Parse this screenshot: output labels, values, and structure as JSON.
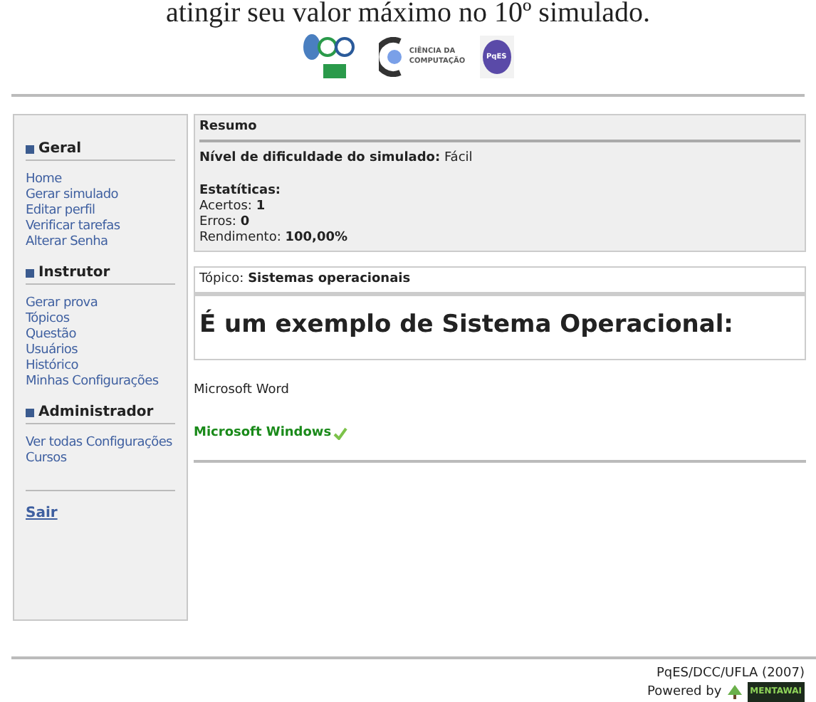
{
  "heading": "atingir seu valor máximo no 10º simulado.",
  "logos": {
    "computacao": [
      "CIÊNCIA DA",
      "COMPUTAÇÃO"
    ],
    "pqes": "PqES"
  },
  "sidebar": {
    "sections": [
      {
        "title": "Geral",
        "items": [
          "Home",
          "Gerar simulado",
          "Editar perfil",
          "Verificar tarefas",
          "Alterar Senha"
        ]
      },
      {
        "title": "Instrutor",
        "items": [
          "Gerar prova",
          "Tópicos",
          "Questão",
          "Usuários",
          "Histórico",
          "Minhas Configurações"
        ]
      },
      {
        "title": "Administrador",
        "items": [
          "Ver todas Configurações",
          "Cursos"
        ]
      }
    ],
    "exit": "Sair"
  },
  "summary": {
    "title": "Resumo",
    "difficulty_label": "Nível de dificuldade do simulado:",
    "difficulty": "Fácil",
    "stats_title": "Estatíticas:",
    "stats": [
      {
        "label": "Acertos:",
        "value": "1"
      },
      {
        "label": "Erros:",
        "value": "0"
      },
      {
        "label": "Rendimento:",
        "value": "100,00%"
      }
    ]
  },
  "question": {
    "topic_label": "Tópico:",
    "topic": "Sistemas operacionais",
    "text": "É um exemplo de Sistema Operacional:",
    "options": [
      {
        "text": "Microsoft Word",
        "correct": false
      },
      {
        "text": "Microsoft Windows",
        "correct": true
      }
    ]
  },
  "footer": {
    "credit": "PqES/DCC/UFLA (2007)",
    "powered_by": "Powered by",
    "brand": "MENTAWAI"
  }
}
